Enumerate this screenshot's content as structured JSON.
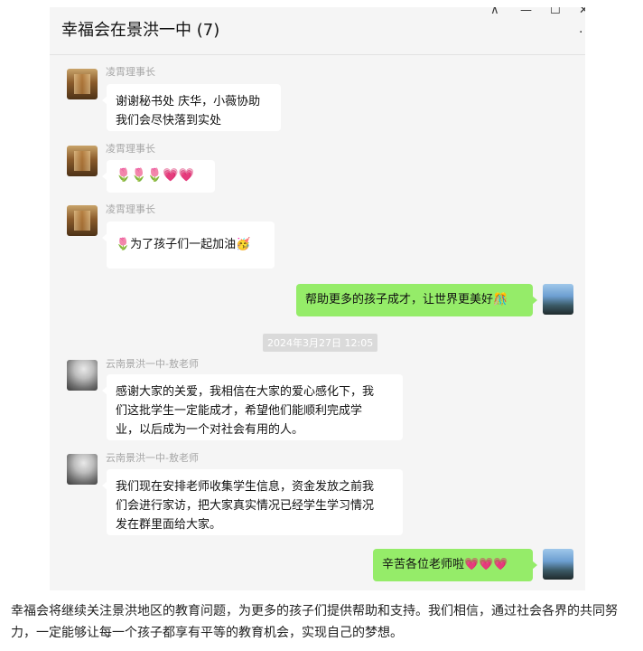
{
  "window": {
    "title": "幸福会在景洪一中 (7)",
    "controls": {
      "pin": "⊼",
      "minimize": "—",
      "maximize": "☐",
      "close": "✕",
      "more": "..."
    }
  },
  "messages": [
    {
      "side": "left",
      "sender": "凌霄理事长",
      "lines": [
        "谢谢秘书处 庆华，小薇协助",
        "我们会尽快落到实处"
      ]
    },
    {
      "side": "left",
      "sender": "凌霄理事长",
      "text": "🌷🌷🌷💗💗"
    },
    {
      "side": "left",
      "sender": "凌霄理事长",
      "text": "🌷为了孩子们一起加油🥳"
    },
    {
      "side": "right",
      "text": "帮助更多的孩子成才，让世界更美好🎊"
    },
    {
      "side": "left",
      "sender": "云南景洪一中-敖老师",
      "lines": [
        "感谢大家的关爱，我相信在大家的爱心感化下，我",
        "们这批学生一定能成才，希望他们能顺利完成学",
        "业，以后成为一个对社会有用的人。"
      ]
    },
    {
      "side": "left",
      "sender": "云南景洪一中-敖老师",
      "lines": [
        "我们现在安排老师收集学生信息，资金发放之前我",
        "们会进行家访，把大家真实情况已经学生学习情况",
        "发在群里面给大家。"
      ]
    },
    {
      "side": "right",
      "text": "辛苦各位老师啦💗💗💗"
    }
  ],
  "timestamp": "2024年3月27日 12:05",
  "caption": "幸福会将继续关注景洪地区的教育问题，为更多的孩子们提供帮助和支持。我们相信，通过社会各界的共同努力，一定能够让每一个孩子都享有平等的教育机会，实现自己的梦想。"
}
